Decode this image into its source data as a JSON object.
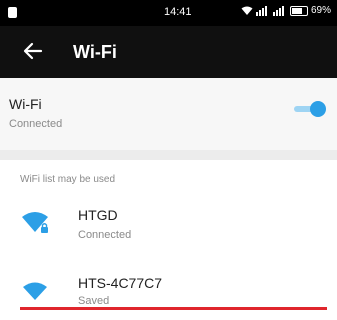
{
  "status_bar": {
    "time": "14:41",
    "battery": "69%",
    "battery_level": 0.69
  },
  "app_bar": {
    "back_icon": "arrow-back-icon",
    "title": "Wi-Fi"
  },
  "wifi_toggle": {
    "label": "Wi-Fi",
    "status": "Connected",
    "enabled": true
  },
  "section": {
    "header": "WiFi list may be used"
  },
  "networks": [
    {
      "name": "HTGD",
      "status": "Connected",
      "icon": "wifi-secured-icon"
    },
    {
      "name": "HTS-4C77C7",
      "status": "Saved",
      "icon": "wifi-icon"
    }
  ],
  "colors": {
    "accent": "#2c9fe6",
    "app_bar": "#101010",
    "highlight": "#e0262d"
  }
}
